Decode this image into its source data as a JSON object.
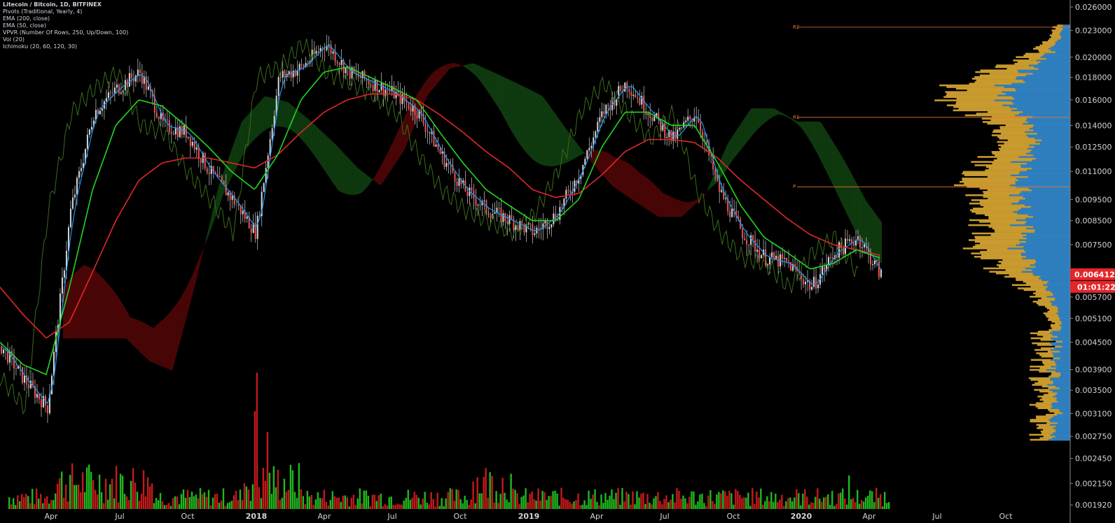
{
  "legend": {
    "symbol": "Litecoin / Bitcoin, 1D, BITFINEX",
    "indicators": [
      "Pivots (Traditional, Yearly, 4)",
      "EMA (200, close)",
      "EMA (50, close)",
      "VPVR (Number Of Rows, 250, Up/Down, 100)",
      "Vol (20)",
      "Ichimoku (20, 60, 120, 30)"
    ]
  },
  "colors": {
    "background": "#000000",
    "up": "#26a69a",
    "down": "#ef5350",
    "ema200": "#e3262a",
    "ema50": "#22d622",
    "tenkan": "#2196f3",
    "chikou": "#3b6b1a",
    "kumo_bull": "#0f3a0f",
    "kumo_bear": "#4a0606",
    "vol_up": "#1fb81f",
    "vol_down": "#c41a1a",
    "vpvr_up": "#2f7fbf",
    "vpvr_down": "#c99a2e",
    "pivot": "#e8772e",
    "price_tag": "#e3262a"
  },
  "price_tag": {
    "price": "0.006412",
    "countdown": "01:01:22"
  },
  "pivots": [
    {
      "label": "R2",
      "value": 0.0234
    },
    {
      "label": "R1",
      "value": 0.0146
    },
    {
      "label": "P",
      "value": 0.01015
    }
  ],
  "chart_data": {
    "type": "line",
    "title": "Litecoin / Bitcoin, 1D, BITFINEX",
    "y_ticks": [
      "0.026000",
      "0.023000",
      "0.020000",
      "0.018000",
      "0.016000",
      "0.014000",
      "0.012500",
      "0.011000",
      "0.009500",
      "0.008500",
      "0.007500",
      "0.006412",
      "0.005700",
      "0.005100",
      "0.004500",
      "0.003900",
      "0.003500",
      "0.003100",
      "0.002750",
      "0.002450",
      "0.002150",
      "0.001920"
    ],
    "y_scale": "log",
    "x_ticks": [
      {
        "label": "Apr",
        "year": false
      },
      {
        "label": "Jul",
        "year": false
      },
      {
        "label": "Oct",
        "year": false
      },
      {
        "label": "2018",
        "year": true
      },
      {
        "label": "Apr",
        "year": false
      },
      {
        "label": "Jul",
        "year": false
      },
      {
        "label": "Oct",
        "year": false
      },
      {
        "label": "2019",
        "year": true
      },
      {
        "label": "Apr",
        "year": false
      },
      {
        "label": "Jul",
        "year": false
      },
      {
        "label": "Oct",
        "year": false
      },
      {
        "label": "2020",
        "year": true
      },
      {
        "label": "Apr",
        "year": false
      },
      {
        "label": "Jul",
        "year": false
      },
      {
        "label": "Oct",
        "year": false
      }
    ],
    "x": [
      "2017-01",
      "2017-02",
      "2017-03",
      "2017-04",
      "2017-05",
      "2017-06",
      "2017-07",
      "2017-08",
      "2017-09",
      "2017-10",
      "2017-11",
      "2017-12",
      "2018-01",
      "2018-02",
      "2018-03",
      "2018-04",
      "2018-05",
      "2018-06",
      "2018-07",
      "2018-08",
      "2018-09",
      "2018-10",
      "2018-11",
      "2018-12",
      "2019-01",
      "2019-02",
      "2019-03",
      "2019-04",
      "2019-05",
      "2019-06",
      "2019-07",
      "2019-08",
      "2019-09",
      "2019-10",
      "2019-11",
      "2019-12",
      "2020-01",
      "2020-02",
      "2020-03"
    ],
    "series": [
      {
        "name": "Price",
        "values": [
          0.0044,
          0.0037,
          0.0032,
          0.009,
          0.015,
          0.017,
          0.0185,
          0.014,
          0.0135,
          0.011,
          0.0095,
          0.008,
          0.018,
          0.019,
          0.0215,
          0.0185,
          0.0175,
          0.0165,
          0.015,
          0.012,
          0.01,
          0.009,
          0.0085,
          0.008,
          0.0088,
          0.011,
          0.015,
          0.0175,
          0.015,
          0.013,
          0.015,
          0.01,
          0.008,
          0.007,
          0.0068,
          0.006,
          0.0072,
          0.0078,
          0.0064
        ]
      },
      {
        "name": "EMA (50, close)",
        "values": [
          0.0045,
          0.004,
          0.0038,
          0.006,
          0.01,
          0.014,
          0.016,
          0.0155,
          0.014,
          0.0125,
          0.011,
          0.01,
          0.012,
          0.016,
          0.0185,
          0.019,
          0.018,
          0.017,
          0.016,
          0.0135,
          0.0115,
          0.01,
          0.0092,
          0.0085,
          0.0085,
          0.0095,
          0.0125,
          0.015,
          0.015,
          0.014,
          0.014,
          0.0115,
          0.0092,
          0.0078,
          0.0072,
          0.0066,
          0.0068,
          0.0073,
          0.007
        ]
      },
      {
        "name": "EMA (200, close)",
        "values": [
          0.006,
          0.0052,
          0.0046,
          0.005,
          0.0065,
          0.0085,
          0.0105,
          0.0115,
          0.0118,
          0.0118,
          0.0115,
          0.0112,
          0.012,
          0.0135,
          0.015,
          0.016,
          0.0165,
          0.0165,
          0.016,
          0.0148,
          0.0135,
          0.0122,
          0.0112,
          0.01,
          0.0096,
          0.0098,
          0.0108,
          0.0122,
          0.013,
          0.013,
          0.0128,
          0.0118,
          0.0105,
          0.0095,
          0.0086,
          0.0079,
          0.0075,
          0.0073,
          0.0071
        ]
      }
    ]
  }
}
